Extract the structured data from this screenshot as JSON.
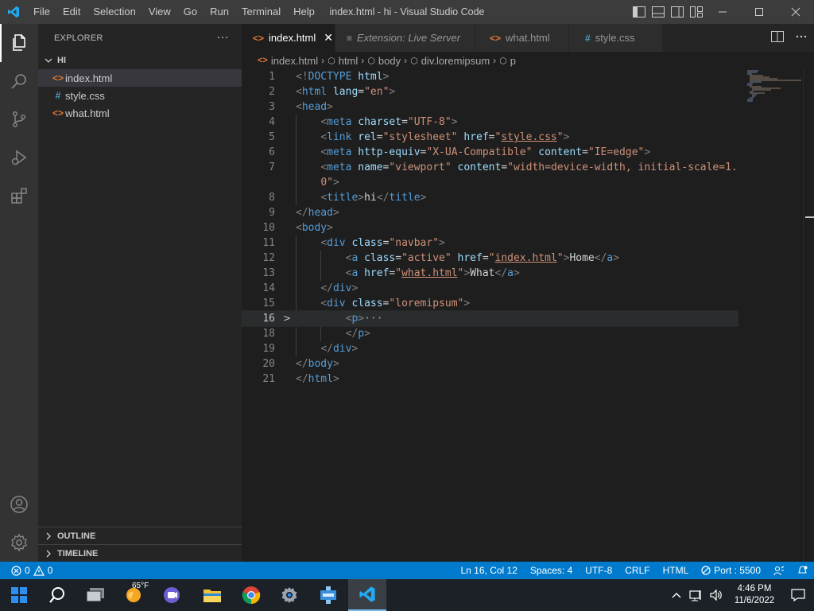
{
  "titlebar": {
    "menu": [
      "File",
      "Edit",
      "Selection",
      "View",
      "Go",
      "Run",
      "Terminal",
      "Help"
    ],
    "title": "index.html - hi - Visual Studio Code"
  },
  "sidebar": {
    "header": "EXPLORER",
    "more": "···",
    "folder": "HI",
    "files": [
      {
        "name": "index.html",
        "icon": "<>",
        "color": "#e37933",
        "selected": true
      },
      {
        "name": "style.css",
        "icon": "#",
        "color": "#519aba",
        "selected": false
      },
      {
        "name": "what.html",
        "icon": "<>",
        "color": "#e37933",
        "selected": false
      }
    ],
    "outline": "OUTLINE",
    "timeline": "TIMELINE"
  },
  "tabs": [
    {
      "label": "index.html",
      "icon": "<>",
      "icon_color": "#e37933",
      "active": true,
      "close": "✕"
    },
    {
      "label": "Extension: Live Server",
      "icon": "≡",
      "icon_color": "#969696",
      "active": false,
      "preview": true
    },
    {
      "label": "what.html",
      "icon": "<>",
      "icon_color": "#e37933",
      "active": false
    },
    {
      "label": "style.css",
      "icon": "#",
      "icon_color": "#519aba",
      "active": false
    }
  ],
  "breadcrumbs": [
    "index.html",
    "html",
    "body",
    "div.loremipsum",
    "p"
  ],
  "editor": {
    "current_line": 16,
    "line_numbers": [
      "1",
      "2",
      "3",
      "4",
      "5",
      "6",
      "7",
      "",
      "8",
      "9",
      "10",
      "11",
      "12",
      "13",
      "14",
      "15",
      "16",
      "18",
      "19",
      "20",
      "21"
    ],
    "fold_marker": ">",
    "ellipsis": "···"
  },
  "statusbar": {
    "errors": "0",
    "warnings": "0",
    "position": "Ln 16, Col 12",
    "spaces": "Spaces: 4",
    "encoding": "UTF-8",
    "eol": "CRLF",
    "language": "HTML",
    "port": "Port : 5500"
  },
  "taskbar": {
    "temperature": "65°F",
    "time": "4:46 PM",
    "date": "11/6/2022"
  },
  "colors": {
    "accent": "#007acc",
    "html_icon": "#e37933",
    "css_icon": "#519aba"
  }
}
